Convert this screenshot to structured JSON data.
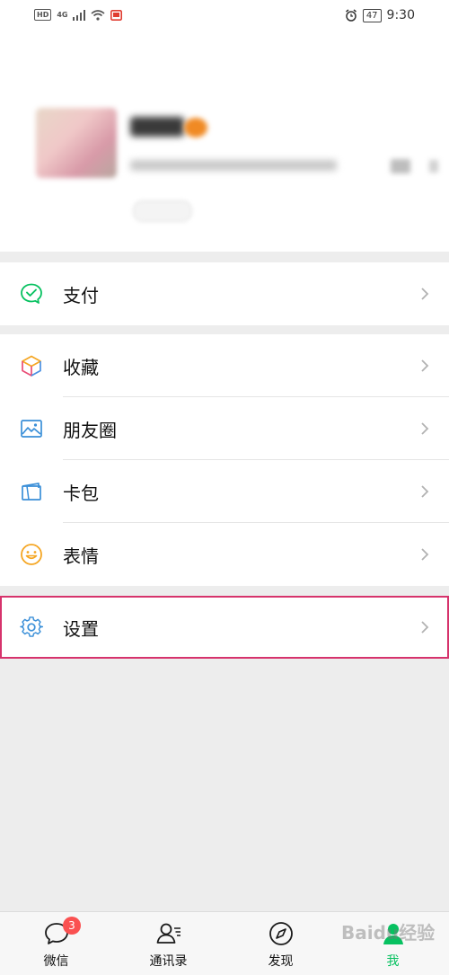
{
  "status_bar": {
    "hd": "HD",
    "network": "4G",
    "battery": "47",
    "time": "9:30"
  },
  "menu": {
    "pay": "支付",
    "favorites": "收藏",
    "moments": "朋友圈",
    "cards": "卡包",
    "stickers": "表情",
    "settings": "设置"
  },
  "tabs": {
    "chats": "微信",
    "chats_badge": "3",
    "contacts": "通讯录",
    "discover": "发现",
    "me": "我"
  },
  "watermark": "Baidu经验",
  "colors": {
    "accent": "#07c160",
    "badge": "#fa5151",
    "highlight_box": "#d6336c"
  },
  "icons": {
    "pay": "wechat-pay-icon",
    "favorites": "cube-icon",
    "moments": "image-icon",
    "cards": "wallet-card-icon",
    "stickers": "smiley-icon",
    "settings": "gear-icon"
  }
}
